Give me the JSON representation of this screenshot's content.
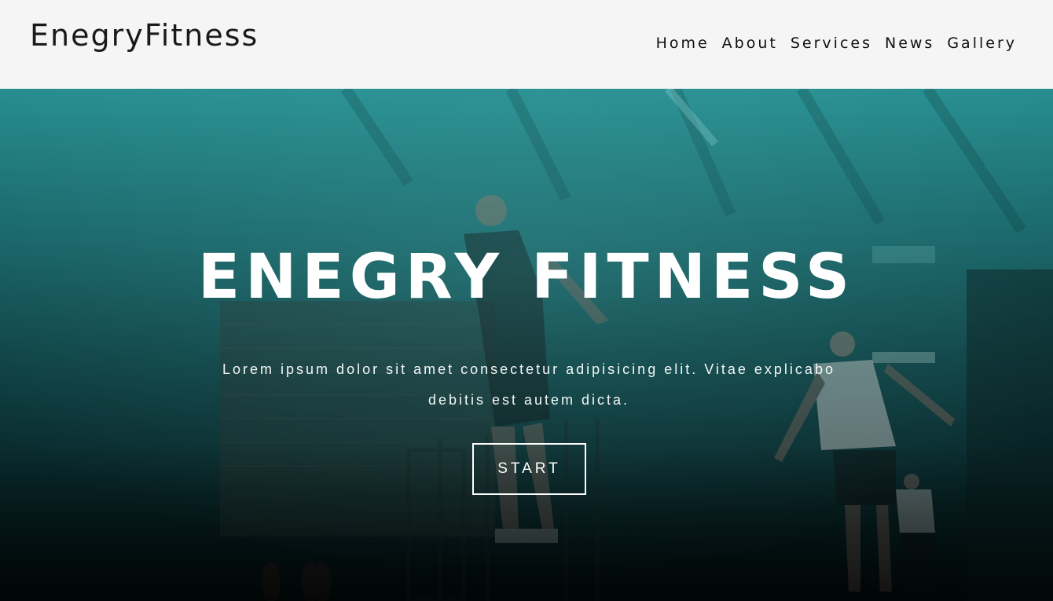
{
  "header": {
    "brand": "EnegryFitness",
    "nav": [
      {
        "label": "Home"
      },
      {
        "label": "About"
      },
      {
        "label": "Services"
      },
      {
        "label": "News"
      },
      {
        "label": "Gallery"
      }
    ]
  },
  "hero": {
    "title": "ENEGRY FITNESS",
    "text": "Lorem ipsum dolor sit amet consectetur adipisicing elit. Vitae explicabo debitis est autem dicta.",
    "button_label": "START"
  },
  "colors": {
    "header_bg": "#f5f5f5",
    "overlay_teal": "#2a9a9c",
    "text_dark": "#1a1a1a",
    "text_light": "#ffffff"
  }
}
